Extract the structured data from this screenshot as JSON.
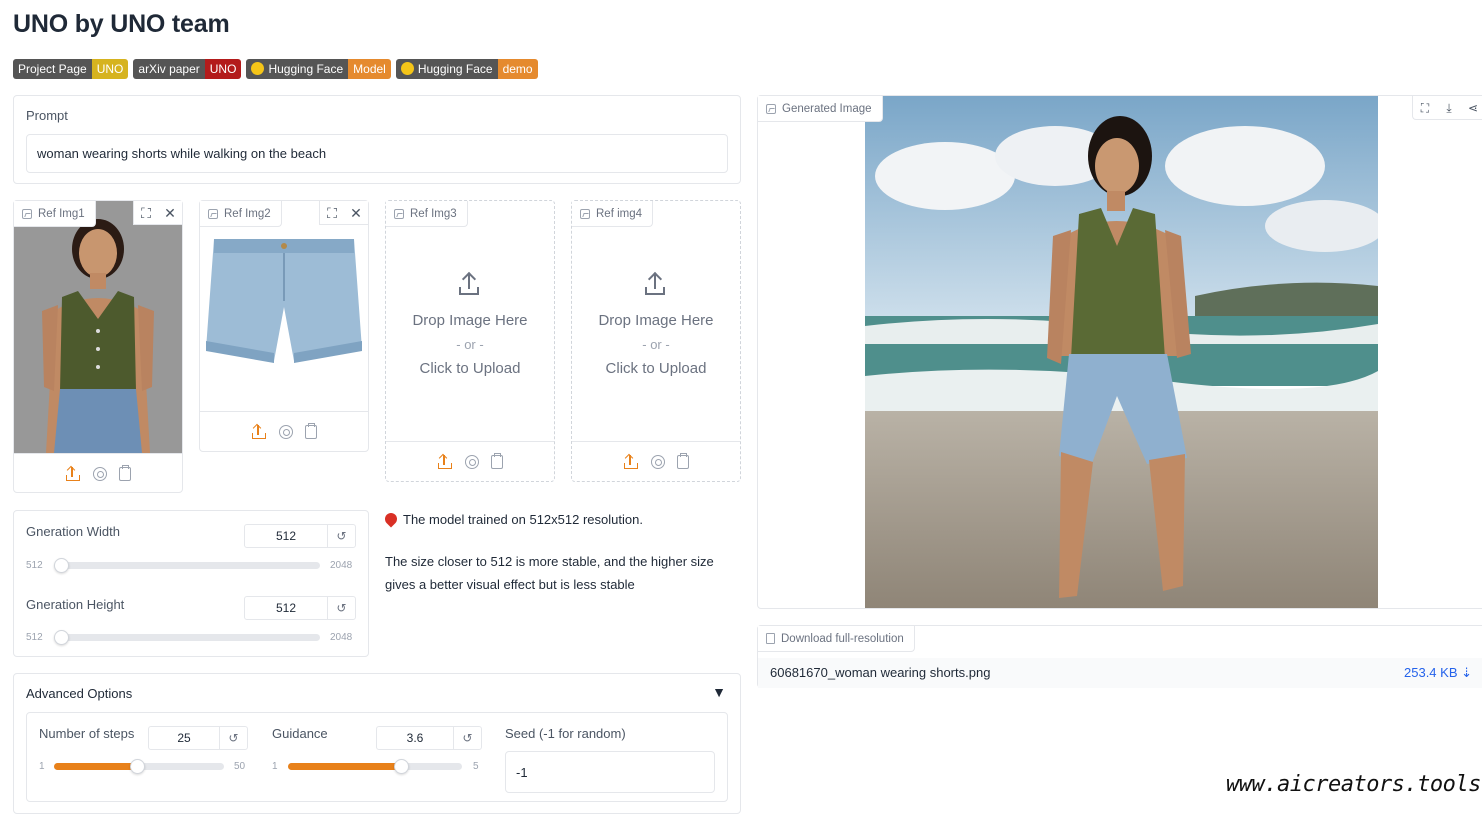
{
  "title": "UNO by UNO team",
  "badges": [
    {
      "left": "Project Page",
      "right": "UNO",
      "right_color": "#d6b31f",
      "emoji": false
    },
    {
      "left": "arXiv paper",
      "right": "UNO",
      "right_color": "#b31b1b",
      "emoji": false
    },
    {
      "left": "Hugging Face",
      "right": "Model",
      "right_color": "#e58a2e",
      "emoji": true
    },
    {
      "left": "Hugging Face",
      "right": "demo",
      "right_color": "#e58a2e",
      "emoji": true
    }
  ],
  "prompt": {
    "label": "Prompt",
    "value": "woman wearing shorts while walking on the beach"
  },
  "refs": [
    {
      "label": "Ref Img1"
    },
    {
      "label": "Ref Img2"
    },
    {
      "label": "Ref Img3"
    },
    {
      "label": "Ref img4"
    }
  ],
  "dropzone": {
    "line1": "Drop Image Here",
    "line2": "- or -",
    "line3": "Click to Upload"
  },
  "sizes": {
    "width": {
      "label": "Gneration Width",
      "value": "512",
      "min": "512",
      "max": "2048"
    },
    "height": {
      "label": "Gneration Height",
      "value": "512",
      "min": "512",
      "max": "2048"
    }
  },
  "info": {
    "line1": "The model trained on 512x512 resolution.",
    "line2": "The size closer to 512 is more stable, and the higher size gives a better visual effect but is less stable"
  },
  "advanced": {
    "title": "Advanced Options",
    "caret": "▼",
    "steps": {
      "label": "Number of steps",
      "value": "25",
      "min": "1",
      "max": "50",
      "fraction": 0.49
    },
    "guidance": {
      "label": "Guidance",
      "value": "3.6",
      "min": "1",
      "max": "5",
      "fraction": 0.65
    },
    "seed": {
      "label": "Seed (-1 for random)",
      "value": "-1"
    }
  },
  "generated": {
    "label": "Generated Image"
  },
  "download": {
    "label": "Download full-resolution",
    "filename": "60681670_woman wearing shorts.png",
    "size": "253.4 KB ⇣"
  },
  "watermark": "www.aicreators.tools",
  "colors": {
    "accent": "#e8811a",
    "link": "#2563eb"
  }
}
